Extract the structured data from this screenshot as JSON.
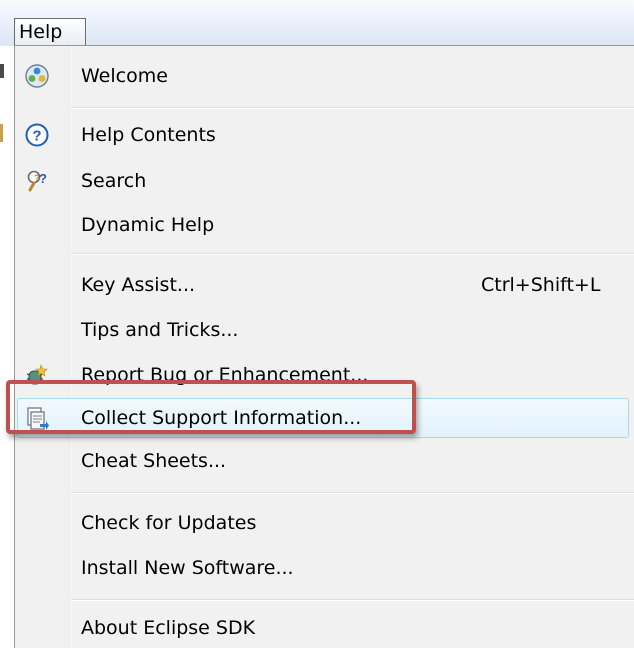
{
  "menubar": {
    "help_label": "Help"
  },
  "menu": {
    "welcome": "Welcome",
    "help_contents": "Help Contents",
    "search": "Search",
    "dynamic_help": "Dynamic Help",
    "key_assist": "Key Assist...",
    "key_assist_shortcut": "Ctrl+Shift+L",
    "tips_and_tricks": "Tips and Tricks...",
    "report_bug": "Report Bug or Enhancement...",
    "collect_support": "Collect Support Information...",
    "cheat_sheets": "Cheat Sheets...",
    "check_updates": "Check for Updates",
    "install_software": "Install New Software...",
    "about": "About Eclipse SDK"
  },
  "icons": {
    "welcome": "welcome-globe-icon",
    "help_contents": "help-question-icon",
    "search": "search-help-icon",
    "report_bug": "bug-report-icon",
    "collect_support": "support-info-icon"
  },
  "colors": {
    "highlight_border": "#c0504d",
    "hover_border": "#a8d8eb",
    "menu_background": "#f1f1f1"
  }
}
